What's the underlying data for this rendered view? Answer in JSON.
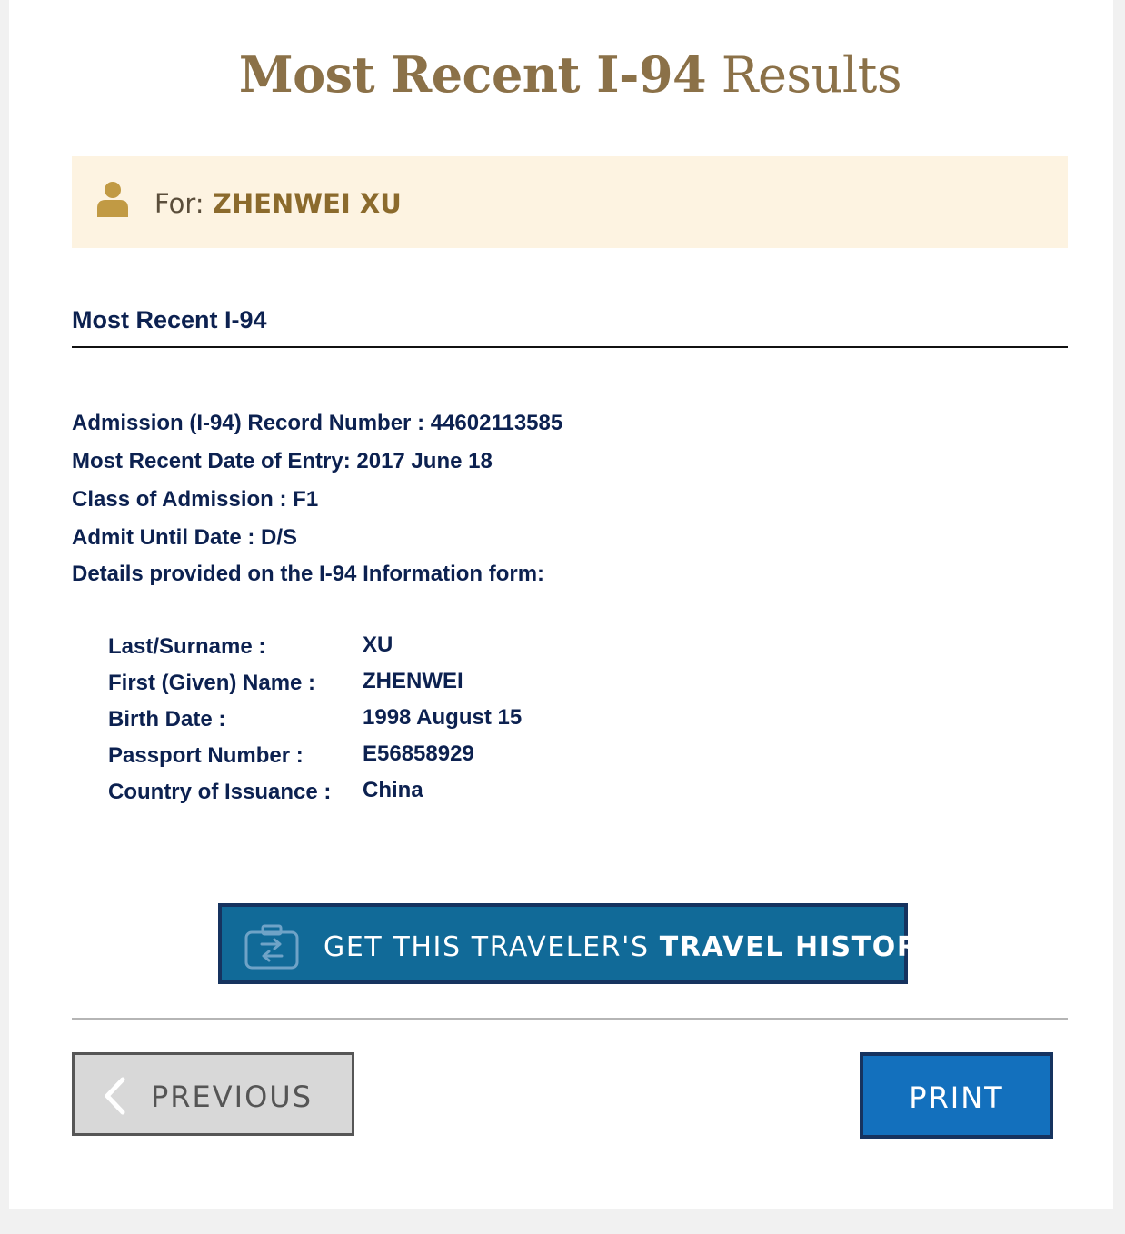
{
  "title": {
    "bold": "Most Recent I-94",
    "regular": "Results"
  },
  "for_banner": {
    "prefix": "For:",
    "name": "ZHENWEI XU",
    "icon": "person-icon"
  },
  "section": {
    "heading": "Most Recent I-94"
  },
  "record": {
    "admission_number": "Admission (I-94) Record Number : 44602113585",
    "entry_date": "Most Recent Date of Entry: 2017 June 18",
    "class_of_admission": "Class of Admission : F1",
    "admit_until": "Admit Until Date : D/S",
    "details_intro": "Details provided on the I-94 Information form:"
  },
  "details": [
    {
      "label": "Last/Surname :",
      "value": "XU"
    },
    {
      "label": "First (Given) Name :",
      "value": "ZHENWEI"
    },
    {
      "label": "Birth Date :",
      "value": "1998 August 15"
    },
    {
      "label": "Passport Number :",
      "value": "E56858929"
    },
    {
      "label": "Country of Issuance :",
      "value": "China"
    }
  ],
  "buttons": {
    "history_prefix": "GET THIS TRAVELER'S",
    "history_bold": "TRAVEL HISTORY",
    "previous": "PREVIOUS",
    "print": "PRINT"
  },
  "colors": {
    "title": "#8b7148",
    "banner_bg": "#fdf3e1",
    "text_navy": "#0c2150",
    "history_bg": "#116a98",
    "print_bg": "#1370bd",
    "previous_bg": "#d8d8d8"
  }
}
